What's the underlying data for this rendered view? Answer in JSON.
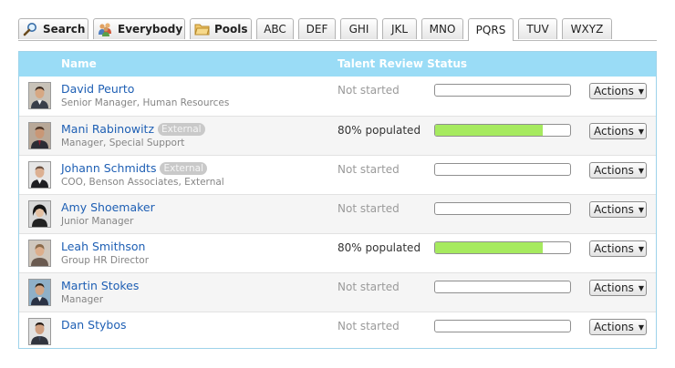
{
  "tabs": [
    {
      "label": "Search",
      "icon": "magnifier-icon",
      "bold": true
    },
    {
      "label": "Everybody",
      "icon": "people-icon",
      "bold": true
    },
    {
      "label": "Pools",
      "icon": "folder-icon",
      "bold": true
    },
    {
      "label": "ABC"
    },
    {
      "label": "DEF"
    },
    {
      "label": "GHI"
    },
    {
      "label": "JKL"
    },
    {
      "label": "MNO"
    },
    {
      "label": "PQRS",
      "active": true
    },
    {
      "label": "TUV"
    },
    {
      "label": "WXYZ"
    }
  ],
  "table": {
    "headers": {
      "name": "Name",
      "status": "Talent Review Status"
    },
    "external_label": "External",
    "actions_label": "Actions",
    "rows": [
      {
        "name": "David Peurto",
        "title": "Senior Manager, Human Resources",
        "external": false,
        "status": "Not started",
        "progress": 0
      },
      {
        "name": "Mani Rabinowitz",
        "title": "Manager, Special Support",
        "external": true,
        "status": "80% populated",
        "progress": 0.8
      },
      {
        "name": "Johann Schmidts",
        "title": "COO, Benson Associates, External",
        "external": true,
        "status": "Not started",
        "progress": 0
      },
      {
        "name": "Amy Shoemaker",
        "title": "Junior Manager",
        "external": false,
        "status": "Not started",
        "progress": 0
      },
      {
        "name": "Leah Smithson",
        "title": "Group HR Director",
        "external": false,
        "status": "80% populated",
        "progress": 0.8
      },
      {
        "name": "Martin Stokes",
        "title": "Manager",
        "external": false,
        "status": "Not started",
        "progress": 0
      },
      {
        "name": "Dan Stybos",
        "title": "",
        "external": false,
        "status": "Not started",
        "progress": 0
      }
    ]
  },
  "colors": {
    "header_bg": "#9adcf6",
    "link": "#1e5fb4",
    "progress_fill": "#a6ea5f"
  }
}
